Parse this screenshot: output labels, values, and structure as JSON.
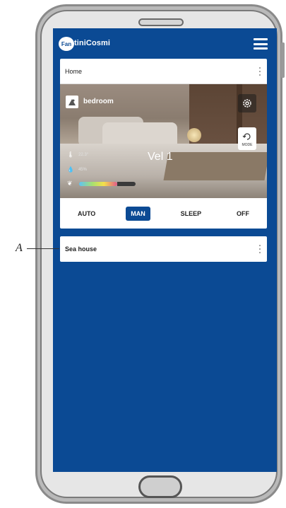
{
  "app": {
    "brand": "FantiniCosmi",
    "logo_text": "Fan",
    "brand_rest": "tiniCosmi"
  },
  "home_card": {
    "title": "Home",
    "room_name": "bedroom",
    "speed_label": "Vel 1",
    "temperature": "22.3°",
    "humidity": "45%",
    "air_quality_level": 0.67,
    "mode_button_label": "MODE",
    "modes": [
      {
        "label": "AUTO",
        "active": false
      },
      {
        "label": "MAN",
        "active": true
      },
      {
        "label": "SLEEP",
        "active": false
      },
      {
        "label": "OFF",
        "active": false
      }
    ]
  },
  "second_card": {
    "title": "Sea house"
  },
  "annotation": {
    "label": "A"
  },
  "colors": {
    "primary": "#0b4a94",
    "card_bg": "#ffffff"
  },
  "icons": {
    "menu": "hamburger-menu-icon",
    "room": "room-icon",
    "settings": "gear-icon",
    "mode": "mode-cycle-icon",
    "temperature": "thermometer-icon",
    "humidity": "drop-icon",
    "air": "leaf-icon"
  }
}
